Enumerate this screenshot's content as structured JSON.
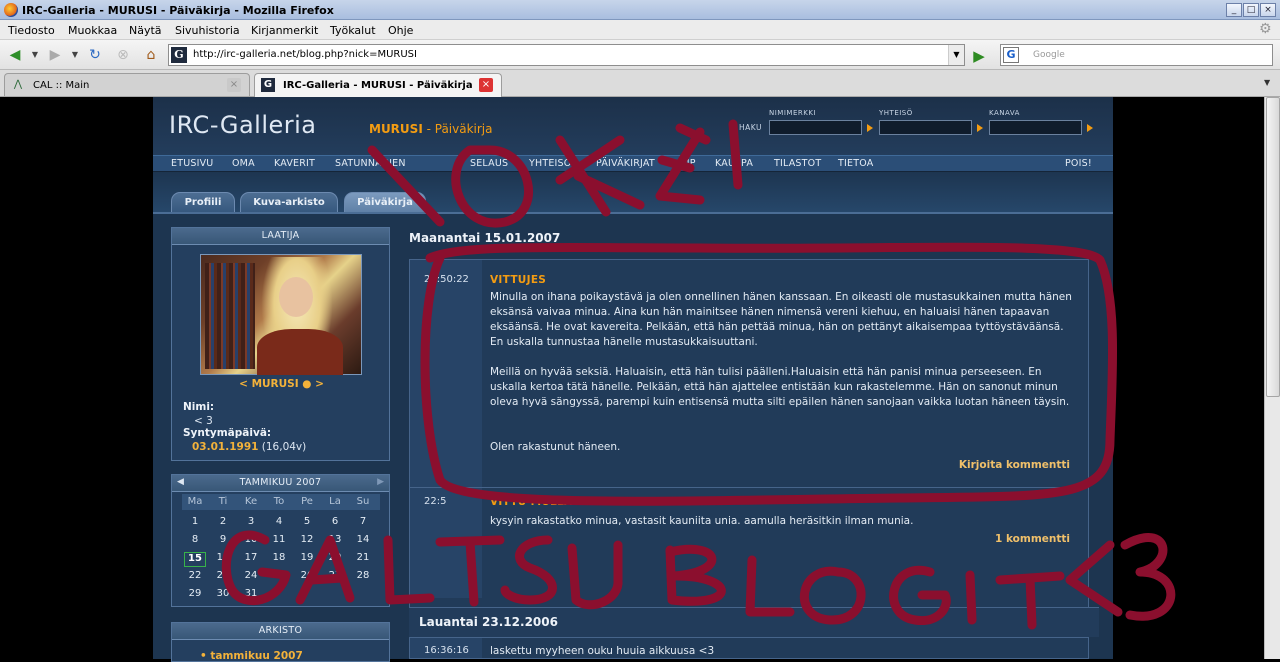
{
  "window": {
    "title": "IRC-Galleria - MURUSI - Päiväkirja - Mozilla Firefox"
  },
  "menu": [
    "Tiedosto",
    "Muokkaa",
    "Näytä",
    "Sivuhistoria",
    "Kirjanmerkit",
    "Työkalut",
    "Ohje"
  ],
  "navbar": {
    "url": "http://irc-galleria.net/blog.php?nick=MURUSI",
    "search_placeholder": "Google"
  },
  "tabs": [
    {
      "label": "CAL :: Main",
      "active": false
    },
    {
      "label": "IRC-Galleria - MURUSI - Päiväkirja",
      "active": true
    }
  ],
  "site": {
    "logo": "IRC-Galleria",
    "nick": "MURUSI",
    "section": " - Päiväkirja",
    "haku": "HAKU",
    "search_labels": [
      "NIMIMERKKI",
      "YHTEISÖ",
      "KANAVA"
    ],
    "nav": [
      "ETUSIVU",
      "OMA",
      "KAVERIT",
      "SATUNNAINEN",
      "SELAUS",
      "YHTEISÖT",
      "PÄIVÄKIRJAT",
      "VIP",
      "KAUPPA",
      "TILASTOT",
      "TIETOA"
    ],
    "logout": "POIS!",
    "profile_tabs": [
      "Profiili",
      "Kuva-arkisto",
      "Päiväkirja"
    ]
  },
  "sidebar": {
    "author_header": "LAATIJA",
    "nick_line": "< MURUSI ● >",
    "name_label": "Nimi:",
    "name_value": "< 3",
    "birthday_label": "Syntymäpäivä:",
    "birthday_value": "03.01.1991",
    "age": "(16,04v)",
    "calendar": {
      "month": "TAMMIKUU 2007",
      "weekdays": [
        "Ma",
        "Ti",
        "Ke",
        "To",
        "Pe",
        "La",
        "Su"
      ],
      "weeks": [
        [
          "1",
          "2",
          "3",
          "4",
          "5",
          "6",
          "7"
        ],
        [
          "8",
          "9",
          "10",
          "11",
          "12",
          "13",
          "14"
        ],
        [
          "15",
          "16",
          "17",
          "18",
          "19",
          "20",
          "21"
        ],
        [
          "22",
          "23",
          "24",
          "25",
          "26",
          "27",
          "28"
        ],
        [
          "29",
          "30",
          "31",
          "",
          "",
          "",
          ""
        ]
      ],
      "today": "15"
    },
    "archive_header": "ARKISTO",
    "archive_item": "• tammikuu 2007"
  },
  "blog": {
    "date1": "Maanantai 15.01.2007",
    "post1": {
      "time": "23:50:22",
      "title": "VITTUJES",
      "p1": "Minulla on ihana poikaystävä ja olen onnellinen hänen kanssaan. En oikeasti ole mustasukkainen mutta hänen eksänsä vaivaa minua. Aina kun hän mainitsee hänen nimensä vereni kiehuu, en haluaisi hänen tapaavan eksäänsä. He ovat kavereita. Pelkään, että hän pettää minua, hän on pettänyt aikaisempaa tyttöystäväänsä. En uskalla tunnustaa hänelle mustasukkaisuuttani.",
      "p2": "Meillä on hyvää seksiä. Haluaisin, että hän tulisi päälleni.Haluaisin että hän panisi minua perseeseen. En uskalla kertoa tätä hänelle. Pelkään, että hän ajattelee entistään kun rakastelemme. Hän on sanonut minun oleva hyvä sängyssä, parempi kuin entisensä mutta silti epäilen hänen sanojaan vaikka luotan häneen täysin.",
      "p3": "Olen rakastunut häneen.",
      "link": "Kirjoita kommentti"
    },
    "post2": {
      "time": "22:5",
      "title": "VITTU MULLA HANSKAT",
      "text": "kysyin rakastatko minua, vastasit kauniita unia. aamulla heräsitkin ilman munia.",
      "link": "1 kommentti"
    },
    "date2": "Lauantai 23.12.2006",
    "post3": {
      "time": "16:36:16",
      "text": "laskettu myyheen ouku huuia aikkuusa <3"
    }
  },
  "overlay": {
    "scribble_top": "lOKE!",
    "scribble_bottom": "GALTSU BLOGIT<3",
    "color": "#8b0f2e"
  }
}
